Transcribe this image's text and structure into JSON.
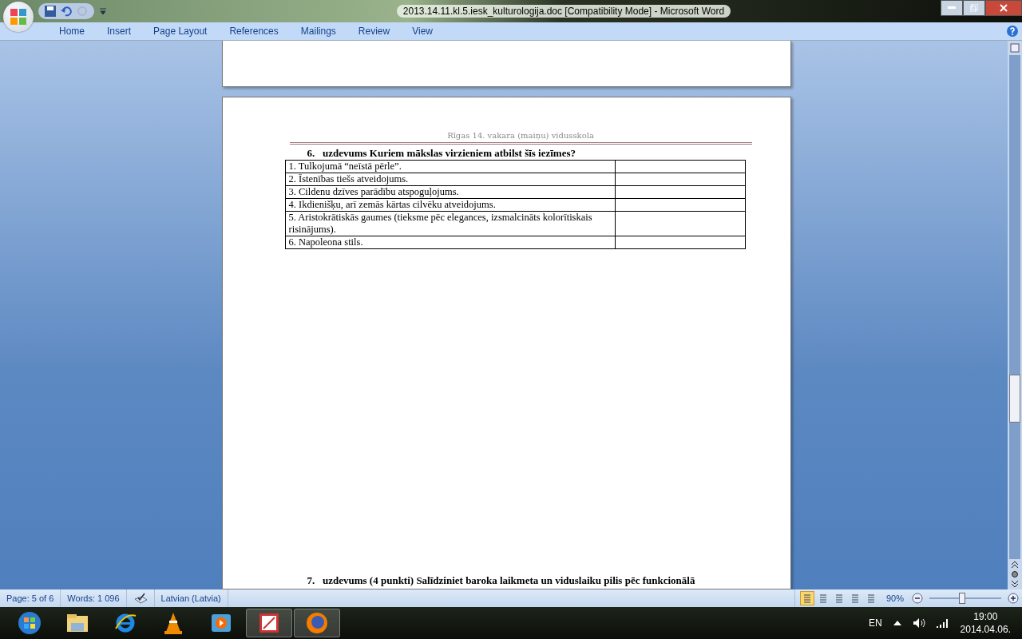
{
  "window": {
    "title": "2013.14.11.kl.5.iesk_kulturologija.doc [Compatibility Mode] - Microsoft Word"
  },
  "ribbon_tabs": [
    {
      "label": "Home",
      "selected": false
    },
    {
      "label": "Insert",
      "selected": false
    },
    {
      "label": "Page Layout",
      "selected": false
    },
    {
      "label": "References",
      "selected": false
    },
    {
      "label": "Mailings",
      "selected": false
    },
    {
      "label": "Review",
      "selected": false
    },
    {
      "label": "View",
      "selected": false
    }
  ],
  "document": {
    "header": "Rīgas 14. vakara (maiņu) vidusskola",
    "task_title": "6.   uzdevums Kuriem mākslas virzieniem atbilst šīs iezīmes?",
    "table_rows": [
      {
        "text": "1. Tulkojumā “neīstā pērle”."
      },
      {
        "text": "2. Īstenības tiešs atveidojums."
      },
      {
        "text": "3. Cildenu dzīves parādību atspoguļojums."
      },
      {
        "text": "4. Ikdienišķu, arī zemās kārtas cilvēku atveidojums."
      },
      {
        "text": "5. Aristokrātiskās gaumes (tieksme pēc elegances, izsmalcināts kolorītiskais risinājums)."
      },
      {
        "text": "6. Napoleona stils."
      }
    ],
    "next_task": "7.   uzdevums (4 punkti) Salīdziniet baroka laikmeta un viduslaiku pilis pēc funkcionālā"
  },
  "status_bar": {
    "page": "Page: 5 of 6",
    "words": "Words: 1 096",
    "language": "Latvian (Latvia)",
    "view_buttons": [
      {
        "selected": true
      },
      {
        "selected": false
      },
      {
        "selected": false
      },
      {
        "selected": false
      },
      {
        "selected": false
      }
    ],
    "zoom": "90%",
    "level": 0.46
  },
  "taskbar": {
    "apps": [
      {
        "selected": false
      },
      {
        "selected": false
      },
      {
        "selected": false
      },
      {
        "selected": false
      },
      {
        "selected": false
      },
      {
        "selected": true
      },
      {
        "selected": true
      }
    ],
    "language": "EN",
    "time": "19:00",
    "date": "2014.04.06."
  }
}
